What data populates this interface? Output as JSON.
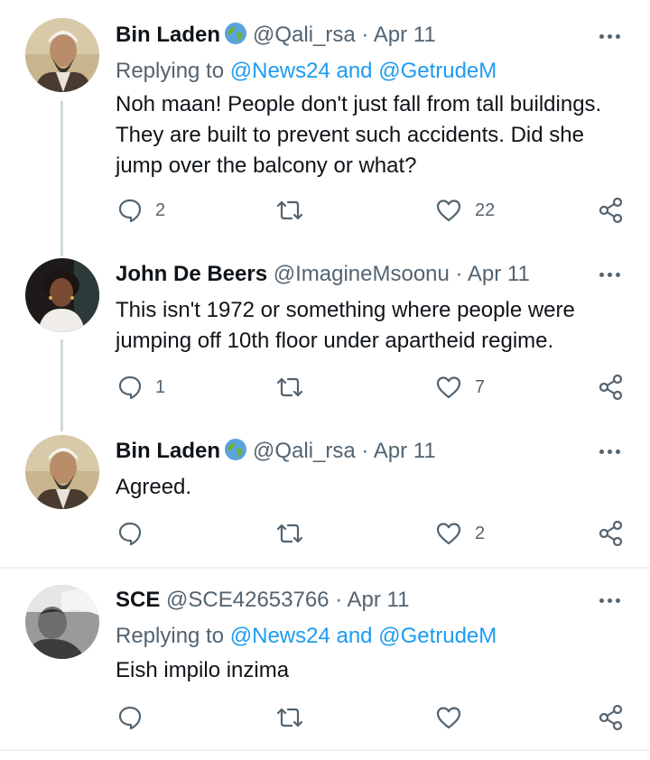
{
  "tweets": [
    {
      "name": "Bin Laden",
      "handle": "@Qali_rsa",
      "date": "· Apr 11",
      "replying_prefix": "Replying to",
      "replying_targets": "@News24 and @GetrudeM",
      "text": "Noh maan! People don't just fall from tall buildings. They are built to prevent such accidents. Did she jump over the balcony or what?",
      "replies": "2",
      "retweets": "",
      "likes": "22",
      "has_globe": true
    },
    {
      "name": "John De Beers",
      "handle": "@ImagineMsoonu",
      "date": "· Apr 11",
      "text": "This isn't 1972 or something where people were jumping off 10th floor under apartheid regime.",
      "replies": "1",
      "retweets": "",
      "likes": "7",
      "has_globe": false
    },
    {
      "name": "Bin Laden",
      "handle": "@Qali_rsa",
      "date": "· Apr 11",
      "text": "Agreed.",
      "replies": "",
      "retweets": "",
      "likes": "2",
      "has_globe": true
    },
    {
      "name": "SCE",
      "handle": "@SCE42653766",
      "date": "· Apr 11",
      "replying_prefix": "Replying to",
      "replying_targets": "@News24 and @GetrudeM",
      "text": "Eish impilo inzima",
      "replies": "",
      "retweets": "",
      "likes": "",
      "has_globe": false
    }
  ],
  "icons": {
    "reply": "reply-bubble-icon",
    "retweet": "retweet-icon",
    "like": "heart-icon",
    "share": "share-icon",
    "more": "more-dots-icon",
    "globe": "globe-emoji-icon"
  },
  "colors": {
    "link": "#1d9bf0",
    "secondary": "#536471",
    "primary_text": "#0f1419",
    "divider": "#eff3f4",
    "thread_line": "#cfd9de"
  }
}
